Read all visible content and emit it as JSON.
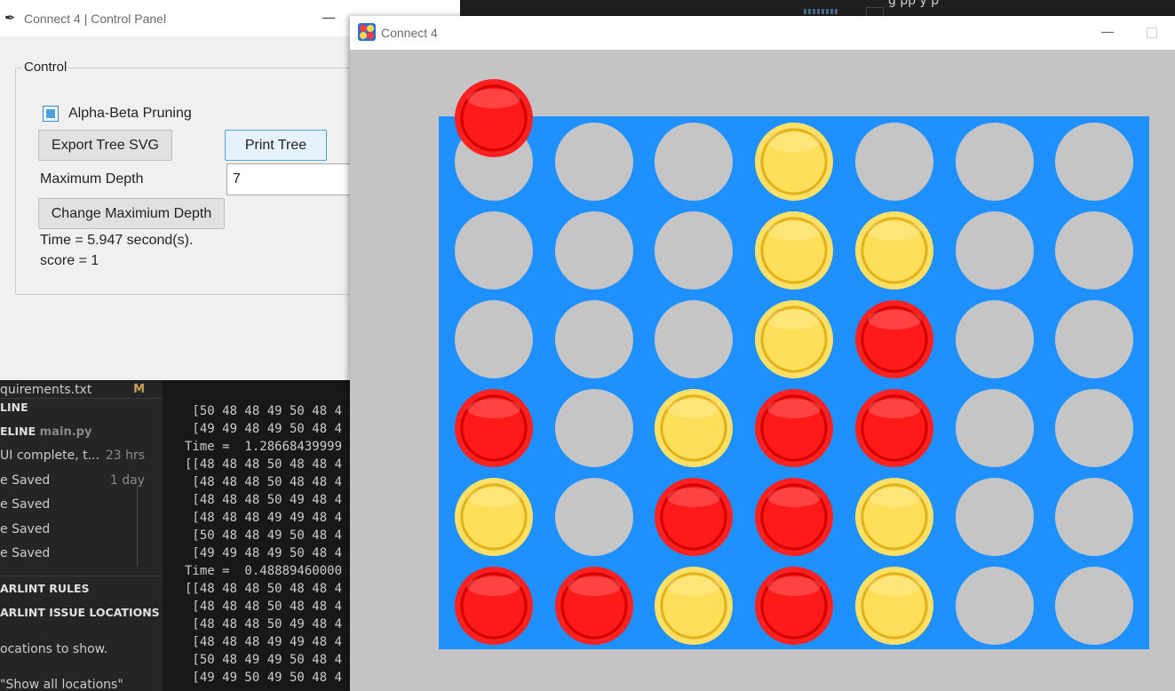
{
  "vscode": {
    "topbar_right": "g    pp        y       p",
    "sidebar": [
      {
        "text": "quirements.txt",
        "right": "M",
        "kind": "file",
        "top": 0
      },
      {
        "text": "LINE",
        "kind": "head"
      },
      {
        "text": "ELINE",
        "muted": "main.py",
        "kind": "head"
      },
      {
        "text": "UI complete, t...",
        "right": "23 hrs",
        "kind": "item"
      },
      {
        "text": "e Saved",
        "right": "1 day",
        "kind": "item"
      },
      {
        "text": "e Saved",
        "kind": "item"
      },
      {
        "text": "e Saved",
        "kind": "item"
      },
      {
        "text": "e Saved",
        "kind": "item"
      },
      {
        "text": "ARLINT RULES",
        "kind": "head"
      },
      {
        "text": "ARLINT ISSUE LOCATIONS",
        "kind": "head"
      },
      {
        "text": "ocations to show.",
        "kind": "item"
      },
      {
        "text": "\"Show all locations\"",
        "kind": "item"
      }
    ],
    "terminal_lines": [
      " [50 48 48 49 50 48 4",
      " [49 49 48 49 50 48 4",
      "Time =  1.28668439999",
      "[[48 48 48 50 48 48 4",
      " [48 48 48 50 48 48 4",
      " [48 48 48 50 49 48 4",
      " [48 48 48 49 49 48 4",
      " [50 48 48 49 50 48 4",
      " [49 49 48 49 50 48 4",
      "Time =  0.48889460000",
      "[[48 48 48 50 48 48 4",
      " [48 48 48 50 48 48 4",
      " [48 48 48 50 49 48 4",
      " [48 48 48 49 49 48 4",
      " [50 48 49 49 50 48 4",
      " [49 49 50 49 50 48 4"
    ]
  },
  "control_panel": {
    "title": "Connect 4 | Control Panel",
    "group_label": "Control",
    "alpha_beta_label": "Alpha-Beta Pruning",
    "alpha_beta_checked": true,
    "export_label": "Export Tree SVG",
    "print_label": "Print Tree",
    "max_depth_label": "Maximum Depth",
    "max_depth_value": "7",
    "change_depth_label": "Change Maximium Depth",
    "time_text": "Time = 5.947 second(s).",
    "score_text": "score = 1"
  },
  "game": {
    "title": "Connect 4",
    "hover_piece": "red",
    "hover_column": 0,
    "board": [
      [
        "empty",
        "empty",
        "empty",
        "yellow",
        "empty",
        "empty",
        "empty"
      ],
      [
        "empty",
        "empty",
        "empty",
        "yellow",
        "yellow",
        "empty",
        "empty"
      ],
      [
        "empty",
        "empty",
        "empty",
        "yellow",
        "red",
        "empty",
        "empty"
      ],
      [
        "red",
        "empty",
        "yellow",
        "red",
        "red",
        "empty",
        "empty"
      ],
      [
        "yellow",
        "empty",
        "red",
        "red",
        "yellow",
        "empty",
        "empty"
      ],
      [
        "red",
        "red",
        "yellow",
        "red",
        "yellow",
        "empty",
        "empty"
      ]
    ],
    "colors": {
      "board": "#1e90ff",
      "red": "#ff1a1a",
      "yellow": "#ffde5a",
      "empty": "#c5c5c5",
      "background": "#c4c4c4"
    }
  }
}
